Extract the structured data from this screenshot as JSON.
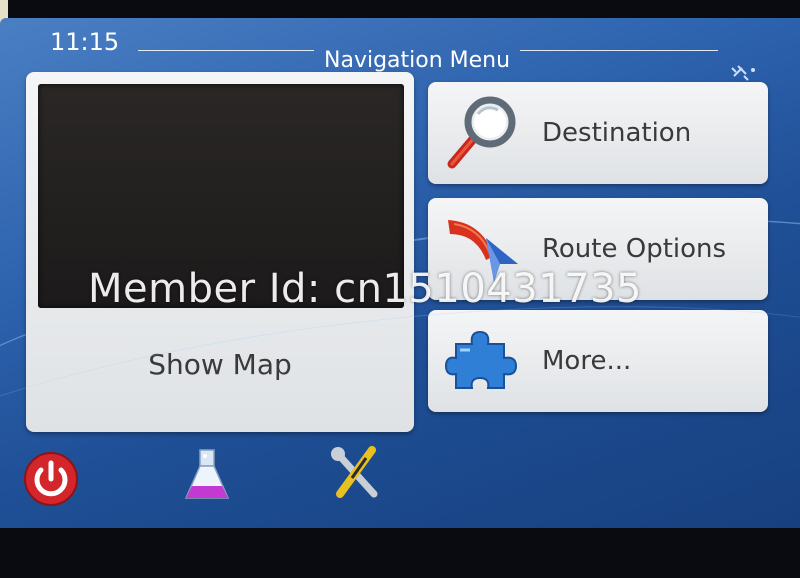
{
  "status": {
    "time": "11:15",
    "title": "Navigation Menu",
    "gps_icon": "satellite-icon"
  },
  "map_tile": {
    "label": "Show Map"
  },
  "menu": [
    {
      "id": "destination",
      "label": "Destination",
      "icon": "magnifier-icon"
    },
    {
      "id": "route-options",
      "label": "Route Options",
      "icon": "route-arrow-icon"
    },
    {
      "id": "more",
      "label": "More...",
      "icon": "puzzle-icon"
    }
  ],
  "bottom_bar": [
    {
      "id": "power",
      "icon": "power-icon"
    },
    {
      "id": "lab",
      "icon": "flask-icon"
    },
    {
      "id": "tools",
      "icon": "tools-icon"
    }
  ],
  "watermark": "Member Id: cn1510431735",
  "colors": {
    "accent_blue": "#2d62ad",
    "tile_bg": "#eceef0",
    "power_red": "#d3262b"
  }
}
